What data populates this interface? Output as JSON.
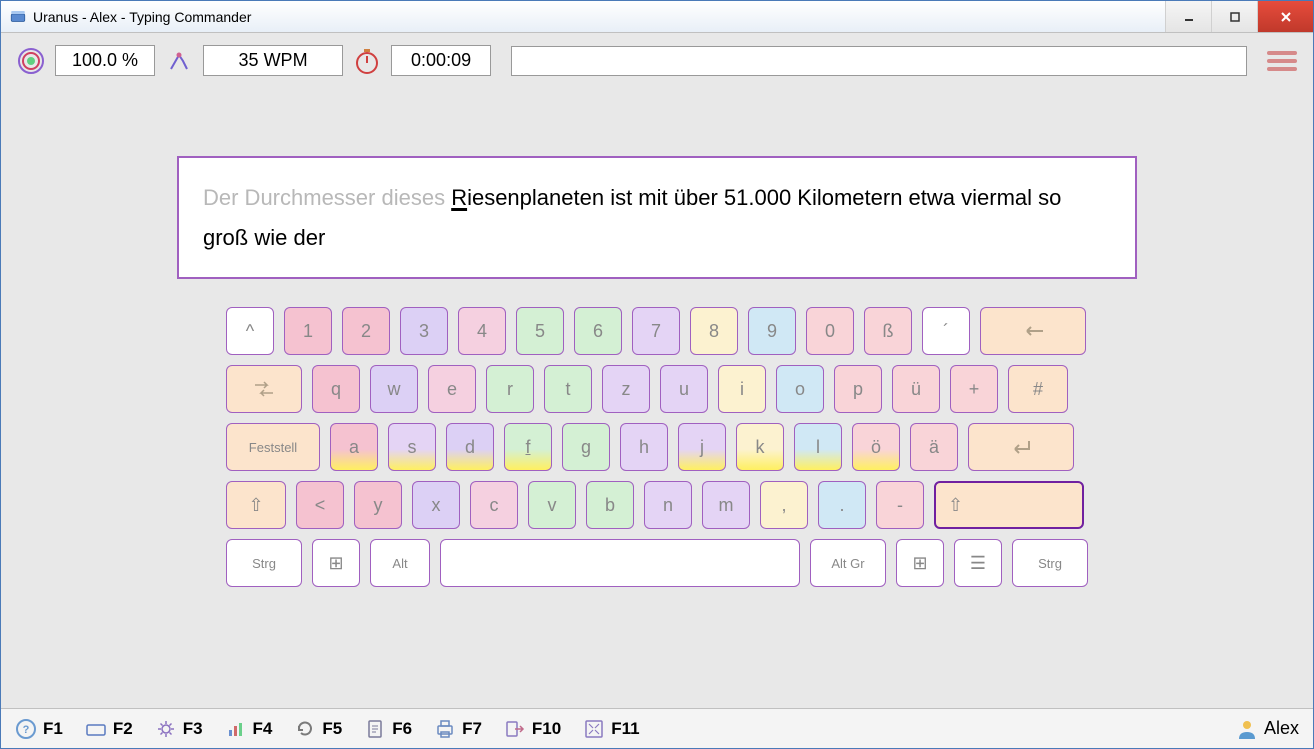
{
  "window": {
    "title": "Uranus - Alex - Typing Commander"
  },
  "stats": {
    "accuracy": "100.0 %",
    "speed": "35 WPM",
    "time": "0:00:09"
  },
  "text": {
    "typed": "Der Durchmesser dieses ",
    "current_char": "R",
    "remaining": "iesenplaneten ist mit über 51.000 Kilometern etwa viermal so groß wie der"
  },
  "keyboard": {
    "row1": [
      "^",
      "1",
      "2",
      "3",
      "4",
      "5",
      "6",
      "7",
      "8",
      "9",
      "0",
      "ß",
      "´",
      "←"
    ],
    "row2": [
      "⇄",
      "q",
      "w",
      "e",
      "r",
      "t",
      "z",
      "u",
      "i",
      "o",
      "p",
      "ü",
      "+",
      "#"
    ],
    "row3": [
      "Feststell",
      "a",
      "s",
      "d",
      "f",
      "g",
      "h",
      "j",
      "k",
      "l",
      "ö",
      "ä",
      "↵"
    ],
    "row4": [
      "⇧",
      "<",
      "y",
      "x",
      "c",
      "v",
      "b",
      "n",
      "m",
      ",",
      ".",
      "-",
      "⇧"
    ],
    "row5": [
      "Strg",
      "⊞",
      "Alt",
      " ",
      "Alt Gr",
      "⊞",
      "☰",
      "Strg"
    ]
  },
  "footer": {
    "keys": [
      "F1",
      "F2",
      "F3",
      "F4",
      "F5",
      "F6",
      "F7",
      "F10",
      "F11"
    ]
  },
  "user": {
    "name": "Alex"
  }
}
